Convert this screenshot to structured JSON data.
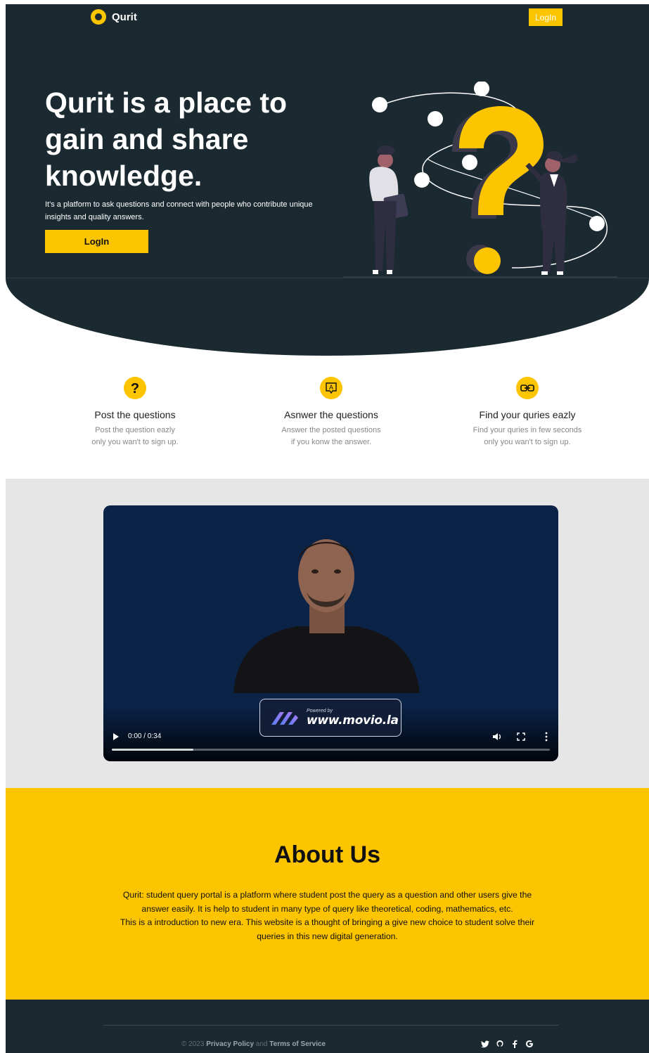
{
  "header": {
    "brand": "Qurit",
    "login_label": "LogIn"
  },
  "hero": {
    "title": "Qurit is a place to gain and share knowledge.",
    "subtitle": "It's a platform to ask questions and connect with people who contribute unique insights and quality answers.",
    "login_label": "LogIn"
  },
  "features": [
    {
      "icon": "question-icon",
      "title": "Post the questions",
      "line1": "Post the question eazly",
      "line2": "only you wan't to sign up."
    },
    {
      "icon": "answer-icon",
      "title": "Asnwer the questions",
      "line1": "Answer the posted questions",
      "line2": "if you konw the answer."
    },
    {
      "icon": "link-icon",
      "title": "Find your quries eazly",
      "line1": "Find your quries in few seconds",
      "line2": "only you wan't to sign up."
    }
  ],
  "video": {
    "time": "0:00 / 0:34",
    "watermark_small": "Powered by",
    "watermark_url": "www.movio.la",
    "buffered_fraction": 0.186
  },
  "about": {
    "title": "About Us",
    "line1": "Qurit: student query portal is a platform where student post the query as a question and other users give the",
    "line2": "answer easily. It is help to student in many type of query like theoretical, coding, mathematics, etc.",
    "line3": "This is a introduction to new era. This website is a thought of bringing a give new choice to student solve their",
    "line4": "queries in this new digital generation."
  },
  "footer": {
    "copyright": "© 2023",
    "privacy": "Privacy Policy",
    "and": "and",
    "terms": "Terms of Service",
    "socials": [
      "twitter-icon",
      "github-icon",
      "facebook-icon",
      "google-icon"
    ]
  },
  "colors": {
    "accent": "#fcc500",
    "dark": "#1b2a31",
    "video_bg": "#0a2347",
    "gray_bg": "#e6e6e6"
  }
}
